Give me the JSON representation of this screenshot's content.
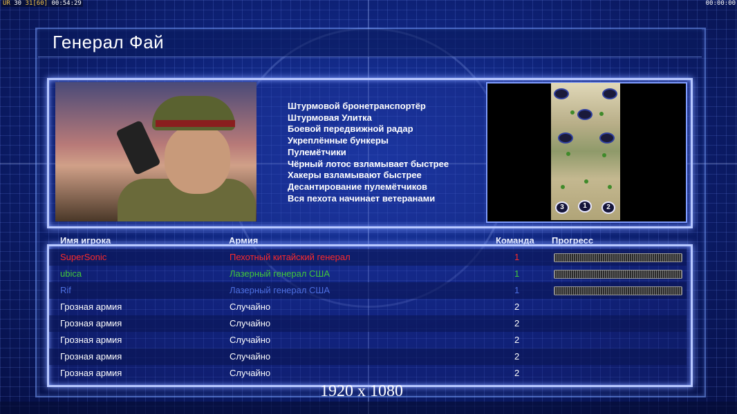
{
  "hud": {
    "left_prefix": "UR",
    "left_a": "30",
    "left_b": "31",
    "left_c": "[60]",
    "left_time": "00:54:29",
    "right_time": "00:00:00"
  },
  "general_title": "Генерал Фай",
  "bonuses": [
    "Штурмовой бронетранспортёр",
    "Штурмовая Улитка",
    "Боевой передвижной радар",
    "Укреплённые бункеры",
    "Пулемётчики",
    "Чёрный лотос взламывает быстрее",
    "Хакеры взламывают быстрее",
    "Десантирование пулемётчиков",
    "Вся пехота начинает ветеранами"
  ],
  "minimap": {
    "slots": [
      "3",
      "1",
      "2"
    ]
  },
  "columns": {
    "player": "Имя игрока",
    "army": "Армия",
    "team": "Команда",
    "progress": "Прогресс"
  },
  "players": [
    {
      "name": "SuperSonic",
      "army": "Пехотный китайский генерал",
      "team": "1",
      "color": "#ff2a2a",
      "progress": 1.0
    },
    {
      "name": "ubica",
      "army": "Лазерный генерал США",
      "team": "1",
      "color": "#43c83b",
      "progress": 1.0
    },
    {
      "name": "Rif",
      "army": "Лазерный генерал США",
      "team": "1",
      "color": "#4d6fe0",
      "progress": 1.0
    },
    {
      "name": "Грозная армия",
      "army": "Случайно",
      "team": "2",
      "color": "#ffffff"
    },
    {
      "name": "Грозная армия",
      "army": "Случайно",
      "team": "2",
      "color": "#ffffff"
    },
    {
      "name": "Грозная армия",
      "army": "Случайно",
      "team": "2",
      "color": "#ffffff"
    },
    {
      "name": "Грозная армия",
      "army": "Случайно",
      "team": "2",
      "color": "#ffffff"
    },
    {
      "name": "Грозная армия",
      "army": "Случайно",
      "team": "2",
      "color": "#ffffff"
    }
  ],
  "resolution_label": "1920 x 1080"
}
